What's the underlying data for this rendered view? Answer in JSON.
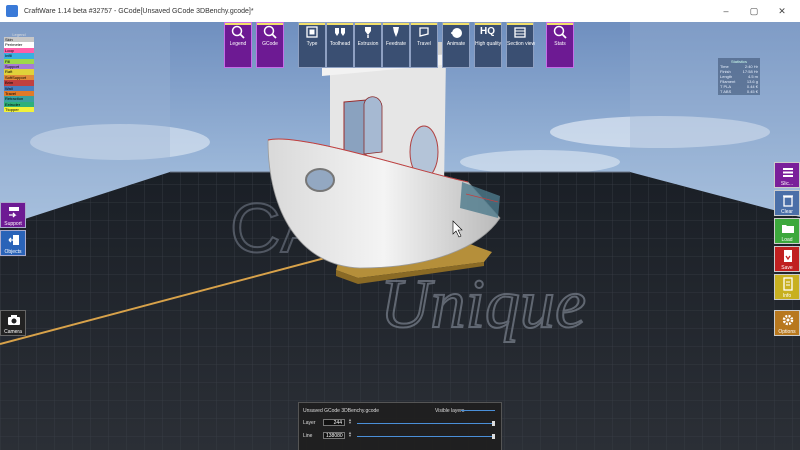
{
  "window": {
    "title": "CraftWare 1.14 beta #32757 - GCode[Unsaved GCode 3DBenchy.gcode]*",
    "controls": [
      "–",
      "▢",
      "✕"
    ]
  },
  "toolbar": {
    "legend": "Legend",
    "gcode": "GCode",
    "type": "Type",
    "tool_head": "Toolhead",
    "extrusion": "Extrusion",
    "feedrate": "Feedrate",
    "travel": "Travel",
    "animate": "Animate",
    "hq_icon": "HQ",
    "high_quality": "High quality",
    "section_view": "Section view",
    "stats": "Stats"
  },
  "legend": {
    "title": "Legend",
    "items": [
      {
        "label": "Skin",
        "color": "#c8c8c8"
      },
      {
        "label": "Perimeter",
        "color": "#ffffff"
      },
      {
        "label": "Loop",
        "color": "#ff5fa8"
      },
      {
        "label": "Infill",
        "color": "#3ab0e0"
      },
      {
        "label": "Fill",
        "color": "#9ed84b"
      },
      {
        "label": "Support",
        "color": "#a77bd6"
      },
      {
        "label": "Raft",
        "color": "#e0d23a"
      },
      {
        "label": "SoftSupport",
        "color": "#e08a3a"
      },
      {
        "label": "Brim",
        "color": "#c14040"
      },
      {
        "label": "Wall",
        "color": "#4a7fbf"
      },
      {
        "label": "Travel",
        "color": "#e07a2a"
      },
      {
        "label": "Retraction",
        "color": "#3aa0a0"
      },
      {
        "label": "Extruder",
        "color": "#2fb07a"
      },
      {
        "label": "Ttopper",
        "color": "#f2f23a"
      }
    ]
  },
  "left_buttons": {
    "support": "Support",
    "objects": "Objects",
    "camera": "Camera"
  },
  "right_buttons": {
    "slice": "Slic...",
    "clear": "Clear",
    "load": "Load",
    "save": "Save",
    "info": "Info",
    "options": "Options"
  },
  "stats": {
    "title": "Statistics",
    "rows": [
      {
        "k": "Time",
        "v": "2:40 Hr"
      },
      {
        "k": "Finish",
        "v": "17:58 Hr"
      },
      {
        "k": "Length",
        "v": "4.5 m"
      },
      {
        "k": "Filament",
        "v": "13.6 g"
      },
      {
        "k": "T PLA",
        "v": "0.44 €"
      },
      {
        "k": "T ABS",
        "v": "0.45 €"
      }
    ]
  },
  "viewport": {
    "watermark": "Unique",
    "watermark_prefix": "CA"
  },
  "layer_panel": {
    "file_name": "Unsaved GCode 3DBenchy.gcode",
    "visible_layers_label": "Visible layers",
    "layer_label": "Layer",
    "layer_value": "244",
    "line_label": "Line",
    "line_value": "138080"
  },
  "colors": {
    "toolbar_purple": "#6d1a93",
    "toolbar_blue": "#3a4f72",
    "slice_purple": "#7a1f9a",
    "clear_blue": "#4a6fa8",
    "load_green": "#3ca83c",
    "save_red": "#c02020",
    "info_yellow": "#c8b020",
    "options_orange": "#b8781e"
  }
}
